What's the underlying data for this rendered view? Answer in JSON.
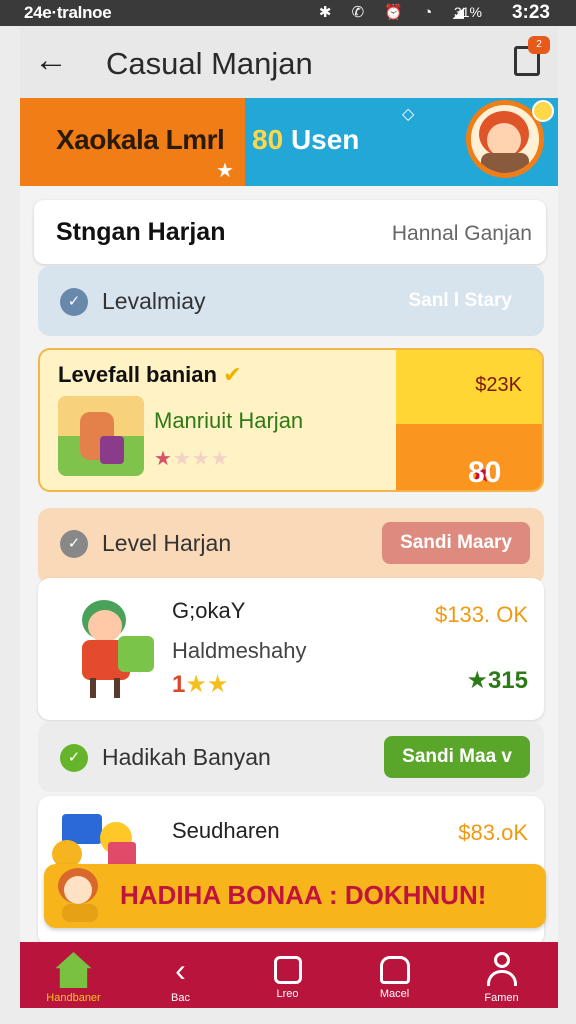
{
  "status_bar": {
    "left_text": "24e·tralnoe",
    "icons": [
      "bluetooth-icon",
      "vibrate-icon",
      "alarm-icon",
      "wifi-icon",
      "signal-icon"
    ],
    "battery": "31%",
    "time": "3:23"
  },
  "app_bar": {
    "title": "Casual Manjan",
    "badge": "2"
  },
  "banner": {
    "left_text": "Xaokala Lmrl",
    "highlight": "80",
    "right_text": "Usen"
  },
  "header_card": {
    "left": "Stngan Harjan",
    "right": "Hannal Ganjan"
  },
  "rows": [
    {
      "label": "Levalmiay",
      "button": "Sanl l Stary"
    },
    {
      "label": "Level Harjan",
      "button": "Sandi Maary"
    },
    {
      "label": "Hadikah Banyan",
      "button": "Sandi Maa v"
    }
  ],
  "featured": {
    "title": "Levefall banian",
    "name": "Manriuit Harjan",
    "stars": "★ᵡᵡ★",
    "price": "$23K",
    "score": "80"
  },
  "card2": {
    "name1": "G;okaY",
    "name2": "Haldmeshahy",
    "stars_num": "1",
    "stars": "★★",
    "price": "$133. OK",
    "score": "315"
  },
  "card3": {
    "name1": "Seudharen",
    "price": "$83.oK"
  },
  "promo": {
    "text": "HADIHA BONAA : DOKHNUN!"
  },
  "bottom_nav": [
    {
      "label": "Handbaner",
      "icon": "home-icon"
    },
    {
      "label": "Bac",
      "icon": "back-icon"
    },
    {
      "label": "Lreo",
      "icon": "square-icon"
    },
    {
      "label": "Macel",
      "icon": "house-icon"
    },
    {
      "label": "Famen",
      "icon": "user-icon"
    }
  ],
  "colors": {
    "accent": "#b8143c",
    "orange": "#f07d16",
    "blue": "#22a7d6",
    "green": "#5aa62a",
    "yellow": "#f7b51b"
  }
}
